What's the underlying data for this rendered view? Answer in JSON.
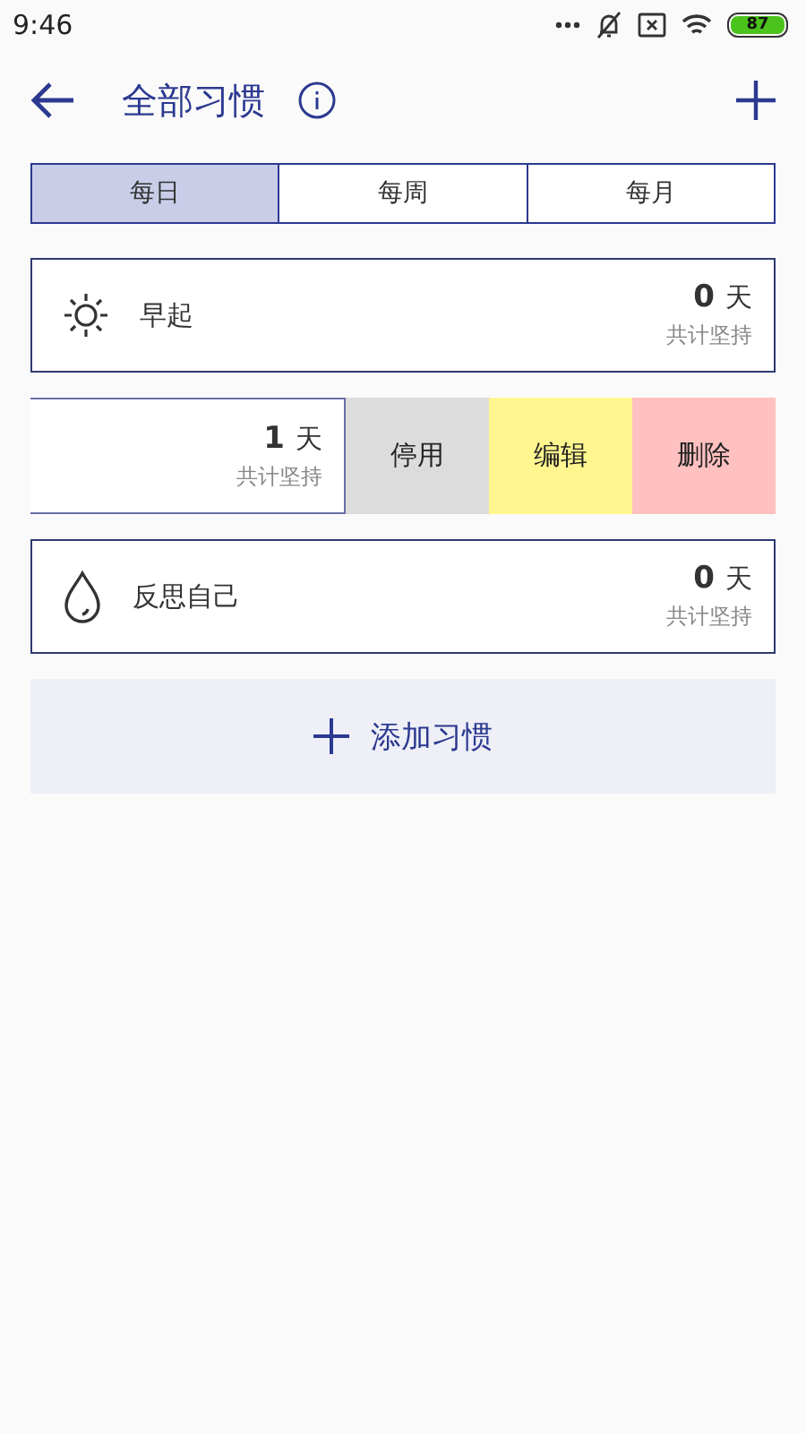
{
  "status_bar": {
    "time": "9:46",
    "battery": "87"
  },
  "header": {
    "title": "全部习惯"
  },
  "tabs": [
    {
      "label": "每日",
      "selected": true
    },
    {
      "label": "每周",
      "selected": false
    },
    {
      "label": "每月",
      "selected": false
    }
  ],
  "habits": [
    {
      "kind": "sun",
      "name": "早起",
      "count": "0",
      "unit": "天",
      "caption": "共计坚持",
      "swiped": false
    },
    {
      "kind": "none",
      "count": "1",
      "unit": "天",
      "caption": "共计坚持",
      "swiped": true,
      "actions": [
        {
          "label": "停用",
          "color": "#dcdcdc"
        },
        {
          "label": "编辑",
          "color": "#fff68f"
        },
        {
          "label": "删除",
          "color": "#ffc0c0"
        }
      ]
    },
    {
      "kind": "drop",
      "name": "反思自己",
      "count": "0",
      "unit": "天",
      "caption": "共计坚持",
      "swiped": false
    }
  ],
  "add_button": {
    "label": "添加习惯"
  }
}
